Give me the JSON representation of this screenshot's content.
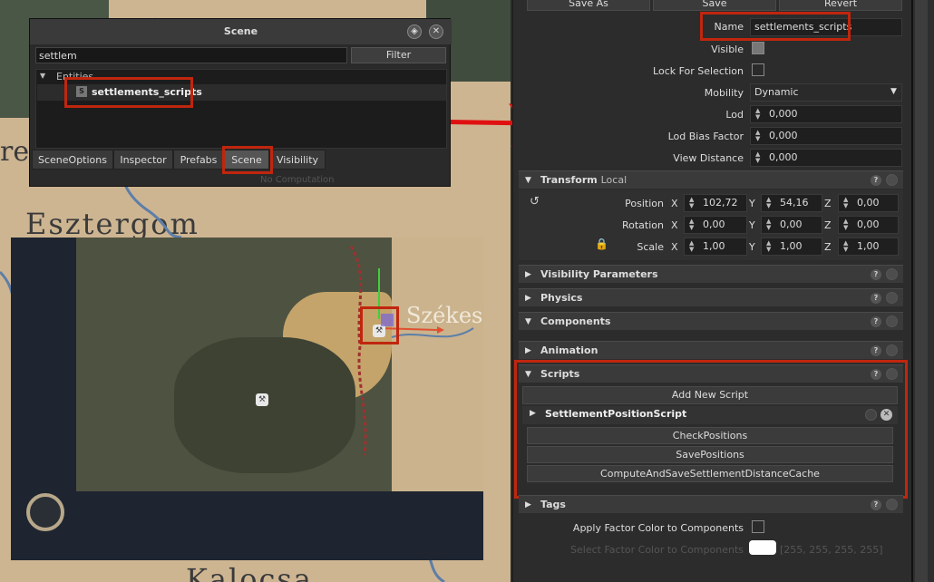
{
  "map": {
    "labels": [
      "Esztergom",
      "Székesfe",
      "Kalocsa",
      "re"
    ]
  },
  "scene_window": {
    "title": "Scene",
    "search_value": "settlem",
    "filter_label": "Filter",
    "tree_root": "Entities",
    "tree_item": "settlements_scripts",
    "tabs": [
      "SceneOptions",
      "Inspector",
      "Prefabs",
      "Scene",
      "Visibility"
    ],
    "active_tab": "Scene",
    "footer_text": "No Computation"
  },
  "inspector": {
    "top_buttons": [
      "Save As",
      "Save",
      "Revert"
    ],
    "name_label": "Name",
    "name_value": "settlements_scripts",
    "visible_label": "Visible",
    "lock_label": "Lock For Selection",
    "mobility_label": "Mobility",
    "mobility_value": "Dynamic",
    "lod_label": "Lod",
    "lod_value": "0,000",
    "lod_bias_label": "Lod Bias Factor",
    "lod_bias_value": "0,000",
    "view_distance_label": "View Distance",
    "view_distance_value": "0,000",
    "transform": {
      "title": "Transform",
      "title_suffix": "Local",
      "position_label": "Position",
      "rotation_label": "Rotation",
      "scale_label": "Scale",
      "position": [
        "102,72",
        "54,16",
        "0,00"
      ],
      "rotation": [
        "0,00",
        "0,00",
        "0,00"
      ],
      "scale": [
        "1,00",
        "1,00",
        "1,00"
      ],
      "axes": [
        "X",
        "Y",
        "Z"
      ]
    },
    "sections": {
      "visibility": "Visibility Parameters",
      "physics": "Physics",
      "components": "Components",
      "animation": "Animation",
      "scripts": "Scripts",
      "tags": "Tags"
    },
    "scripts": {
      "add_label": "Add New Script",
      "script_name": "SettlementPositionScript",
      "buttons": [
        "CheckPositions",
        "SavePositions",
        "ComputeAndSaveSettlementDistanceCache"
      ]
    },
    "apply_factor_label": "Apply Factor Color to Components",
    "select_factor_label": "Select Factor Color to Components",
    "factor_value": "[255, 255, 255, 255]"
  },
  "colors": {
    "highlight_red": "#c0260e",
    "arrow_red": "#e01010"
  }
}
